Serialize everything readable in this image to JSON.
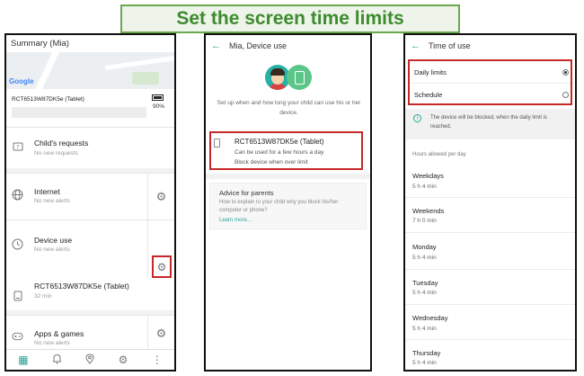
{
  "banner": {
    "title": "Set the screen time limits"
  },
  "summary": {
    "title": "Summary (Mia)",
    "map_logo": "Google",
    "device_name": "RCT6513W87DK5e (Tablet)",
    "battery": "90%",
    "rows": [
      {
        "title": "Child's requests",
        "subtitle": "No new requests"
      },
      {
        "title": "Internet",
        "subtitle": "No new alerts"
      },
      {
        "title": "Device use",
        "subtitle": "No new alerts"
      },
      {
        "title": "RCT6513W87DK5e (Tablet)",
        "subtitle": "32 min"
      },
      {
        "title": "Apps & games",
        "subtitle": "No new alerts"
      }
    ]
  },
  "device_use": {
    "title": "Mia, Device use",
    "description": "Set up when and how long your child can use his or her device.",
    "card": {
      "title": "RCT6513W87DK5e (Tablet)",
      "line1": "Can be used for a few hours a day",
      "line2": "Block device when over limit"
    },
    "advice": {
      "title": "Advice for parents",
      "text": "How to explain to your child why you block his/her computer or phone?",
      "link": "Learn more..."
    }
  },
  "time_of_use": {
    "title": "Time of use",
    "options": [
      {
        "label": "Daily limits",
        "selected": true
      },
      {
        "label": "Schedule",
        "selected": false
      }
    ],
    "info": "The device will be blocked, when the daily limit is reached.",
    "hours_label": "Hours allowed per day",
    "days": [
      {
        "name": "Weekdays",
        "value": "5 h 4 min"
      },
      {
        "name": "Weekends",
        "value": "7 h 0 min"
      },
      {
        "name": "Monday",
        "value": "5 h 4 min"
      },
      {
        "name": "Tuesday",
        "value": "5 h 4 min"
      },
      {
        "name": "Wednesday",
        "value": "5 h 4 min"
      },
      {
        "name": "Thursday",
        "value": "5 h 4 min"
      }
    ]
  },
  "colors": {
    "accent": "#26a69a",
    "highlight": "#c62828",
    "banner_green": "#3d8b2e"
  },
  "icons": {
    "nav": [
      "dashboard-icon",
      "bell-icon",
      "location-pin-icon",
      "gear-icon",
      "more-vertical-icon"
    ]
  }
}
